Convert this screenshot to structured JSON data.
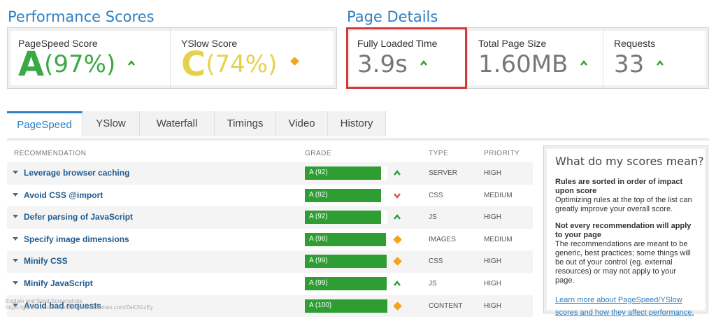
{
  "performance": {
    "title": "Performance Scores",
    "pagespeed": {
      "label": "PageSpeed Score",
      "grade": "A",
      "score": "(97%)"
    },
    "yslow": {
      "label": "YSlow Score",
      "grade": "C",
      "score": "(74%)"
    }
  },
  "details": {
    "title": "Page Details",
    "load_time": {
      "label": "Fully Loaded Time",
      "value": "3.9s"
    },
    "page_size": {
      "label": "Total Page Size",
      "value": "1.60MB"
    },
    "requests": {
      "label": "Requests",
      "value": "33"
    }
  },
  "tabs": [
    {
      "label": "PageSpeed",
      "active": true
    },
    {
      "label": "YSlow"
    },
    {
      "label": "Waterfall"
    },
    {
      "label": "Timings"
    },
    {
      "label": "Video"
    },
    {
      "label": "History"
    }
  ],
  "table": {
    "headers": {
      "recommendation": "RECOMMENDATION",
      "grade": "GRADE",
      "type": "TYPE",
      "priority": "PRIORITY"
    },
    "rows": [
      {
        "name": "Leverage browser caching",
        "grade": "A (92)",
        "score": 92,
        "trend": "up",
        "type": "SERVER",
        "priority": "HIGH"
      },
      {
        "name": "Avoid CSS @import",
        "grade": "A (92)",
        "score": 92,
        "trend": "down",
        "type": "CSS",
        "priority": "MEDIUM"
      },
      {
        "name": "Defer parsing of JavaScript",
        "grade": "A (92)",
        "score": 92,
        "trend": "up",
        "type": "JS",
        "priority": "HIGH"
      },
      {
        "name": "Specify image dimensions",
        "grade": "A (98)",
        "score": 98,
        "trend": "same",
        "type": "IMAGES",
        "priority": "MEDIUM"
      },
      {
        "name": "Minify CSS",
        "grade": "A (99)",
        "score": 99,
        "trend": "same",
        "type": "CSS",
        "priority": "HIGH"
      },
      {
        "name": "Minify JavaScript",
        "grade": "A (99)",
        "score": 99,
        "trend": "up",
        "type": "JS",
        "priority": "HIGH"
      },
      {
        "name": "Avoid bad requests",
        "grade": "A (100)",
        "score": 100,
        "trend": "same",
        "type": "CONTENT",
        "priority": "HIGH"
      }
    ]
  },
  "info": {
    "title": "What do my scores mean?",
    "head1": "Rules are sorted in order of impact upon score",
    "text1": "Optimizing rules at the top of the list can greatly improve your overall score.",
    "head2": "Not every recommendation will apply to your page",
    "text2": "The recommendations are meant to be generic, best practices; some things will be out of your control (eg. external resources) or may not apply to your page.",
    "link": "Learn more about PageSpeed/YSlow scores and how they affect performance."
  },
  "colors": {
    "accent": "#2f7fc1",
    "grade_a": "#3aa845",
    "grade_c": "#e6d24a",
    "bar_green": "#2e9e33",
    "trend_up": "#2e9e33",
    "trend_down": "#d9534f",
    "trend_same": "#f4a31c",
    "highlight": "#d33a3a"
  },
  "watermark": {
    "line1": "Explain and Send Screenshots",
    "line2": "https://gtmetrix.com/reports/www.ilothemes.com/ZaK3GzEy"
  }
}
